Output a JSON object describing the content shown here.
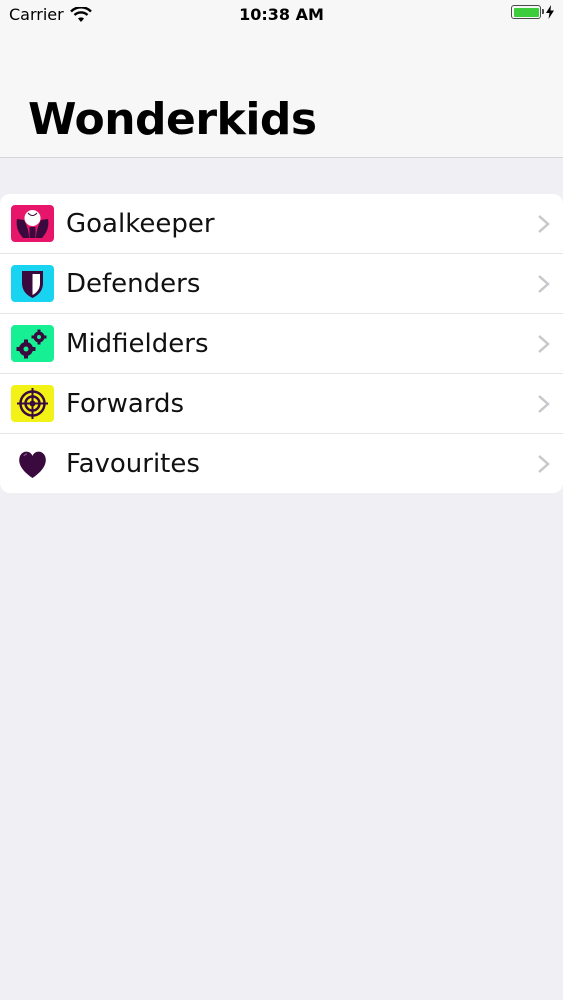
{
  "status_bar": {
    "carrier": "Carrier",
    "time": "10:38 AM",
    "battery_level": 1.0
  },
  "nav": {
    "title": "Wonderkids"
  },
  "list": {
    "items": [
      {
        "label": "Goalkeeper",
        "icon": "goalkeeper-gloves-icon",
        "color": "#e8166a"
      },
      {
        "label": "Defenders",
        "icon": "shield-icon",
        "color": "#18d4f0"
      },
      {
        "label": "Midfielders",
        "icon": "gears-icon",
        "color": "#16ef94"
      },
      {
        "label": "Forwards",
        "icon": "target-icon",
        "color": "#f2f216"
      },
      {
        "label": "Favourites",
        "icon": "heart-icon",
        "color": "#ffffff"
      }
    ]
  },
  "colors": {
    "icon_glyph": "#3a0a3e",
    "chevron": "#c7c7cc"
  }
}
